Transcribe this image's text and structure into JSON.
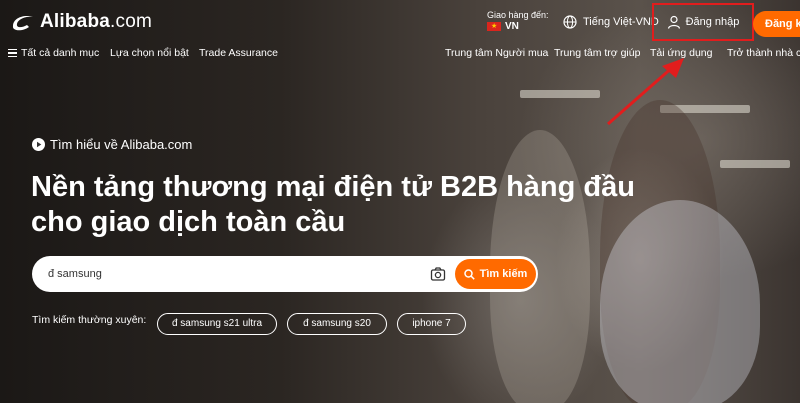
{
  "brand": {
    "logo_text": "Alibaba",
    "logo_suffix": ".com"
  },
  "header": {
    "ship_to_label": "Giao hàng đến:",
    "ship_to_country": "VN",
    "language": "Tiếng Việt-VND",
    "signin_label": "Đăng nhập",
    "register_label": "Đăng k"
  },
  "nav": {
    "all_categories": "Tất cả danh mục",
    "featured": "Lựa chọn nổi bật",
    "trade_assurance": "Trade Assurance",
    "buyer_center": "Trung tâm Người mua",
    "help_center": "Trung tâm trợ giúp",
    "app_download": "Tải ứng dụng",
    "become_supplier": "Trở thành nhà cun"
  },
  "hero": {
    "learn_link": "Tìm hiểu về Alibaba.com",
    "headline_line1": "Nền tảng thương mại điện tử B2B hàng đầu",
    "headline_line2": "cho giao dịch toàn cầu"
  },
  "search": {
    "value": "đ samsung",
    "button_label": "Tìm kiếm"
  },
  "frequent": {
    "label": "Tìm kiếm thường xuyên:",
    "chips": [
      "đ samsung s21 ultra",
      "đ samsung s20",
      "iphone 7"
    ]
  },
  "colors": {
    "accent": "#ff6a00",
    "highlight_box": "#e11d1d",
    "annotation_arrow": "#e11d1d"
  }
}
